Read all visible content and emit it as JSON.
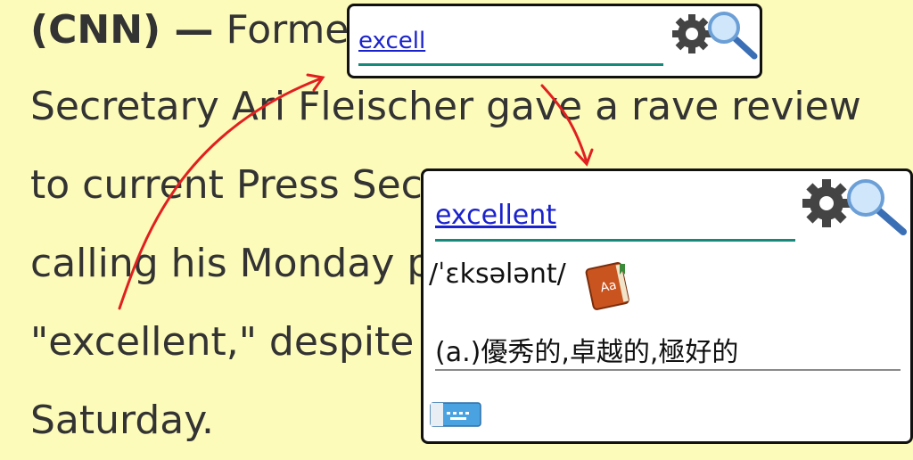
{
  "article": {
    "lines": [
      {
        "bold": "(CNN) —",
        "text": " Former"
      },
      {
        "text": "Secretary Ari Fleischer gave a rave review"
      },
      {
        "text": "to current Press Sec"
      },
      {
        "text": "calling his Monday p"
      },
      {
        "text": "\"excellent,\" despite a"
      },
      {
        "text": "Saturday."
      }
    ]
  },
  "popup_small": {
    "query": "excell",
    "icons": [
      "gear-icon",
      "search-icon"
    ]
  },
  "popup_large": {
    "word": "excellent",
    "phonetic": "/ˈɛksələnt/",
    "definition": "(a.)優秀的,卓越的,極好的",
    "icons": [
      "gear-icon",
      "search-icon",
      "dictionary-book-icon",
      "keyboard-icon"
    ]
  },
  "colors": {
    "page_background": "#fdfbb9",
    "link": "#1a22cc",
    "underline_accent": "#16897a",
    "annotation_arrow": "#e02020"
  }
}
